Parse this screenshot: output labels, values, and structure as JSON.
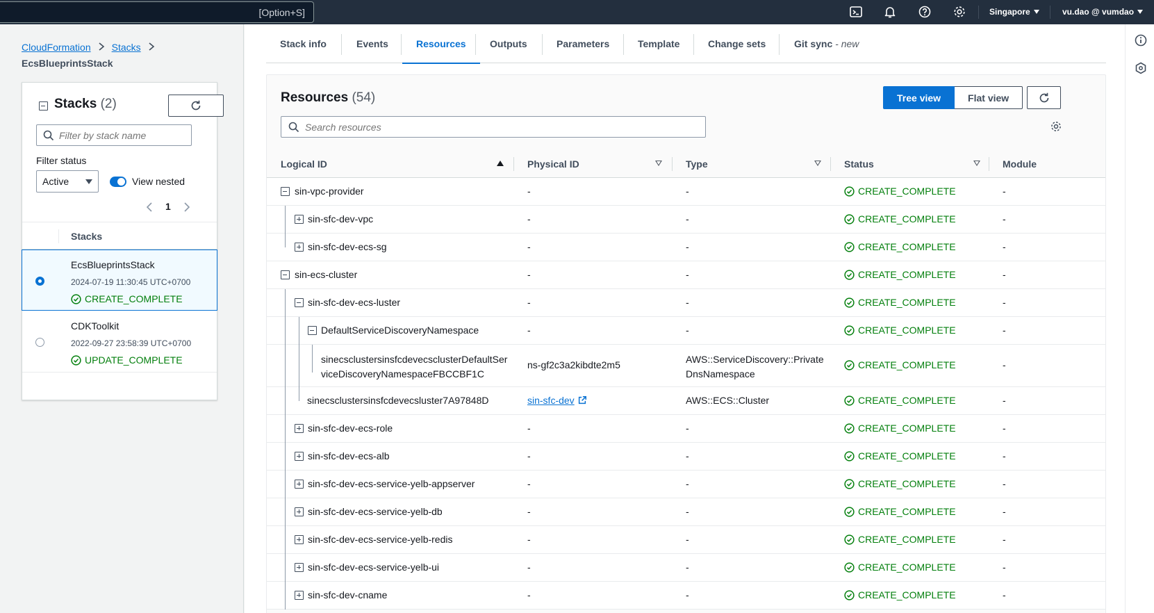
{
  "topnav": {
    "search_shortcut": "[Option+S]",
    "region": "Singapore",
    "account": "vu.dao @ vumdao"
  },
  "breadcrumbs": {
    "root": "CloudFormation",
    "stacks": "Stacks",
    "current": "EcsBlueprintsStack"
  },
  "stacks_panel": {
    "title": "Stacks",
    "count": "(2)",
    "filter_placeholder": "Filter by stack name",
    "filter_status_label": "Filter status",
    "filter_status_value": "Active",
    "view_nested_label": "View nested",
    "page": "1",
    "column_header": "Stacks",
    "rows": [
      {
        "name": "EcsBlueprintsStack",
        "date": "2024-07-19 11:30:45 UTC+0700",
        "status": "CREATE_COMPLETE",
        "selected": true
      },
      {
        "name": "CDKToolkit",
        "date": "2022-09-27 23:58:39 UTC+0700",
        "status": "UPDATE_COMPLETE",
        "selected": false
      }
    ]
  },
  "tabs": [
    {
      "label": "Stack info"
    },
    {
      "label": "Events"
    },
    {
      "label": "Resources"
    },
    {
      "label": "Outputs"
    },
    {
      "label": "Parameters"
    },
    {
      "label": "Template"
    },
    {
      "label": "Change sets"
    },
    {
      "label": "Git sync",
      "suffix": "- new"
    }
  ],
  "resources": {
    "title": "Resources",
    "count": "(54)",
    "tree_view_label": "Tree view",
    "flat_view_label": "Flat view",
    "search_placeholder": "Search resources",
    "columns": {
      "logical_id": "Logical ID",
      "physical_id": "Physical ID",
      "type": "Type",
      "status": "Status",
      "module": "Module"
    },
    "rows": [
      {
        "logical_id": "sin-vpc-provider",
        "physical_id": "-",
        "type": "-",
        "status": "CREATE_COMPLETE",
        "module": "-"
      },
      {
        "logical_id": "sin-sfc-dev-vpc",
        "physical_id": "-",
        "type": "-",
        "status": "CREATE_COMPLETE",
        "module": "-"
      },
      {
        "logical_id": "sin-sfc-dev-ecs-sg",
        "physical_id": "-",
        "type": "-",
        "status": "CREATE_COMPLETE",
        "module": "-"
      },
      {
        "logical_id": "sin-ecs-cluster",
        "physical_id": "-",
        "type": "-",
        "status": "CREATE_COMPLETE",
        "module": "-"
      },
      {
        "logical_id": "sin-sfc-dev-ecs-luster",
        "physical_id": "-",
        "type": "-",
        "status": "CREATE_COMPLETE",
        "module": "-"
      },
      {
        "logical_id": "DefaultServiceDiscoveryNamespace",
        "physical_id": "-",
        "type": "-",
        "status": "CREATE_COMPLETE",
        "module": "-"
      },
      {
        "logical_id": "sinecsclustersinsfcdevecsclusterDefaultServiceDiscoveryNamespaceFBCCBF1C",
        "physical_id": "ns-gf2c3a2kibdte2m5",
        "type": "AWS::ServiceDiscovery::PrivateDnsNamespace",
        "status": "CREATE_COMPLETE",
        "module": "-"
      },
      {
        "logical_id": "sinecsclustersinsfcdevecsluster7A97848D",
        "physical_id": "sin-sfc-dev",
        "type": "AWS::ECS::Cluster",
        "status": "CREATE_COMPLETE",
        "module": "-"
      },
      {
        "logical_id": "sin-sfc-dev-ecs-role",
        "physical_id": "-",
        "type": "-",
        "status": "CREATE_COMPLETE",
        "module": "-"
      },
      {
        "logical_id": "sin-sfc-dev-ecs-alb",
        "physical_id": "-",
        "type": "-",
        "status": "CREATE_COMPLETE",
        "module": "-"
      },
      {
        "logical_id": "sin-sfc-dev-ecs-service-yelb-appserver",
        "physical_id": "-",
        "type": "-",
        "status": "CREATE_COMPLETE",
        "module": "-"
      },
      {
        "logical_id": "sin-sfc-dev-ecs-service-yelb-db",
        "physical_id": "-",
        "type": "-",
        "status": "CREATE_COMPLETE",
        "module": "-"
      },
      {
        "logical_id": "sin-sfc-dev-ecs-service-yelb-redis",
        "physical_id": "-",
        "type": "-",
        "status": "CREATE_COMPLETE",
        "module": "-"
      },
      {
        "logical_id": "sin-sfc-dev-ecs-service-yelb-ui",
        "physical_id": "-",
        "type": "-",
        "status": "CREATE_COMPLETE",
        "module": "-"
      },
      {
        "logical_id": "sin-sfc-dev-cname",
        "physical_id": "-",
        "type": "-",
        "status": "CREATE_COMPLETE",
        "module": "-"
      }
    ]
  },
  "colors": {
    "nav_bg": "#232f3e",
    "accent": "#0972d3",
    "success": "#037f0c"
  },
  "icons": [
    "cloudshell-icon",
    "notifications-icon",
    "help-icon",
    "settings-icon",
    "refresh-icon",
    "search-icon",
    "external-link-icon",
    "info-icon",
    "hexagon-icon",
    "status-success-icon"
  ]
}
